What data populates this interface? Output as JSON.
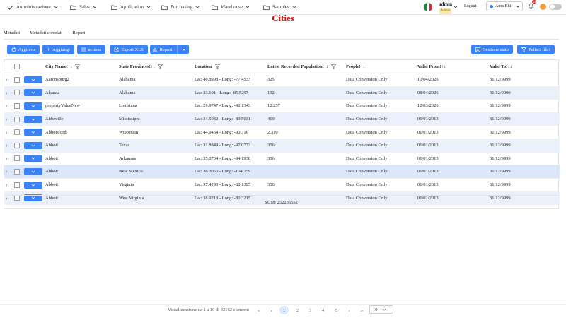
{
  "nav": {
    "items": [
      {
        "label": "Amministrazione",
        "icon": "check-icon"
      },
      {
        "label": "Sales",
        "icon": "folder-icon"
      },
      {
        "label": "Application",
        "icon": "folder-icon"
      },
      {
        "label": "Purchasing",
        "icon": "folder-icon"
      },
      {
        "label": "Warehouse",
        "icon": "folder-icon"
      },
      {
        "label": "Samples",
        "icon": "folder-icon"
      }
    ]
  },
  "user": {
    "name": "admin",
    "role": "Admin",
    "logout": "Logout",
    "theme": "Aura Blü",
    "notifications": "13"
  },
  "page": {
    "title": "Cities"
  },
  "tabs": [
    "Metadati",
    "Metadati correlati",
    "Report"
  ],
  "toolbar": {
    "refresh": "Aggiorna",
    "add": "Aggiungi",
    "actions": "actions",
    "export": "Export XLS",
    "report": "Report",
    "state": "Gestione stato",
    "clear_filters": "Pulisci filtri"
  },
  "table": {
    "headers": [
      "City Name!↑↓",
      "State Provinces!↑↓",
      "Location",
      "Latest Recorded Population!↑↓",
      "People!↑↓",
      "Valid From!↑↓",
      "Valid To!↑↓"
    ],
    "rows": [
      [
        "Aaronsburg2",
        "Alabama",
        "Lat: 40.8998 - Long: -77.4533",
        "325",
        "Data Conversion Only",
        "10/04/2026",
        "31/12/9999"
      ],
      [
        "Abanda",
        "Alabama",
        "Lat: 33.101 - Long: -85.5297",
        "192",
        "Data Conversion Only",
        "08/04/2026",
        "31/12/9999"
      ],
      [
        "propertyValueNew",
        "Louisiana",
        "Lat: 29.9747 - Long: -92.1343",
        "12.257",
        "Data Conversion Only",
        "12/03/2026",
        "31/12/9999"
      ],
      [
        "Abbeville",
        "Mississippi",
        "Lat: 34.5032 - Long: -89.5031",
        "419",
        "Data Conversion Only",
        "01/01/2013",
        "31/12/9999"
      ],
      [
        "Abbotsford",
        "Wisconsin",
        "Lat: 44.9464 - Long: -90.316",
        "2.310",
        "Data Conversion Only",
        "01/01/2013",
        "31/12/9999"
      ],
      [
        "Abbott",
        "Texas",
        "Lat: 31.8849 - Long: -97.0733",
        "356",
        "Data Conversion Only",
        "01/01/2013",
        "31/12/9999"
      ],
      [
        "Abbott",
        "Arkansas",
        "Lat: 35.0734 - Long: -94.1938",
        "356",
        "Data Conversion Only",
        "01/01/2013",
        "31/12/9999"
      ],
      [
        "Abbott",
        "New Mexico",
        "Lat: 36.3056 - Long: -104.259",
        "",
        "Data Conversion Only",
        "01/01/2013",
        "31/12/9999"
      ],
      [
        "Abbott",
        "Virginia",
        "Lat: 37.4293 - Long: -80.1395",
        "356",
        "Data Conversion Only",
        "01/01/2013",
        "31/12/9999"
      ],
      [
        "Abbott",
        "West Virginia",
        "Lat: 38.9218 - Long: -80.3215",
        "",
        "Data Conversion Only",
        "01/01/2013",
        "31/12/9999"
      ]
    ],
    "sum": "SUM: 252235552"
  },
  "pager": {
    "info": "Visualizzazione da 1 a 10 di 42162 elementi",
    "pages": [
      "1",
      "2",
      "3",
      "4",
      "5"
    ],
    "per_page": "10"
  },
  "colors": {
    "accent": "#3b82f6",
    "title": "#dd1111"
  }
}
